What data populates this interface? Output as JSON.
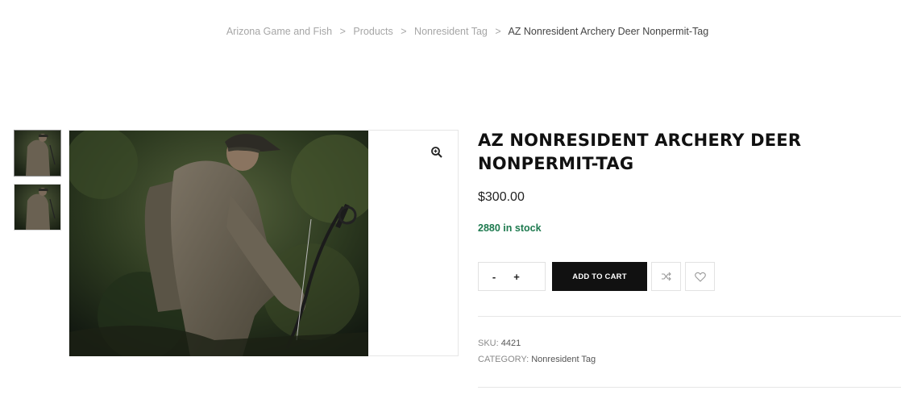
{
  "breadcrumb": {
    "items": [
      "Arizona Game and Fish",
      "Products",
      "Nonresident Tag"
    ],
    "current": "AZ Nonresident Archery Deer Nonpermit-Tag",
    "separator": ">"
  },
  "product": {
    "title": "AZ NONRESIDENT ARCHERY DEER NONPERMIT-TAG",
    "price": "$300.00",
    "stock": "2880 in stock",
    "quantity": {
      "minus": "-",
      "plus": "+",
      "value": ""
    },
    "add_to_cart_label": "ADD TO CART",
    "sku_label": "SKU:",
    "sku": "4421",
    "category_label": "CATEGORY:",
    "category": "Nonresident Tag"
  },
  "icons": {
    "zoom": "zoom-in-icon",
    "compare": "shuffle-icon",
    "wishlist": "heart-icon"
  },
  "colors": {
    "stock": "#1e7a4f",
    "button": "#111111",
    "breadcrumb": "#a6a6a6"
  }
}
